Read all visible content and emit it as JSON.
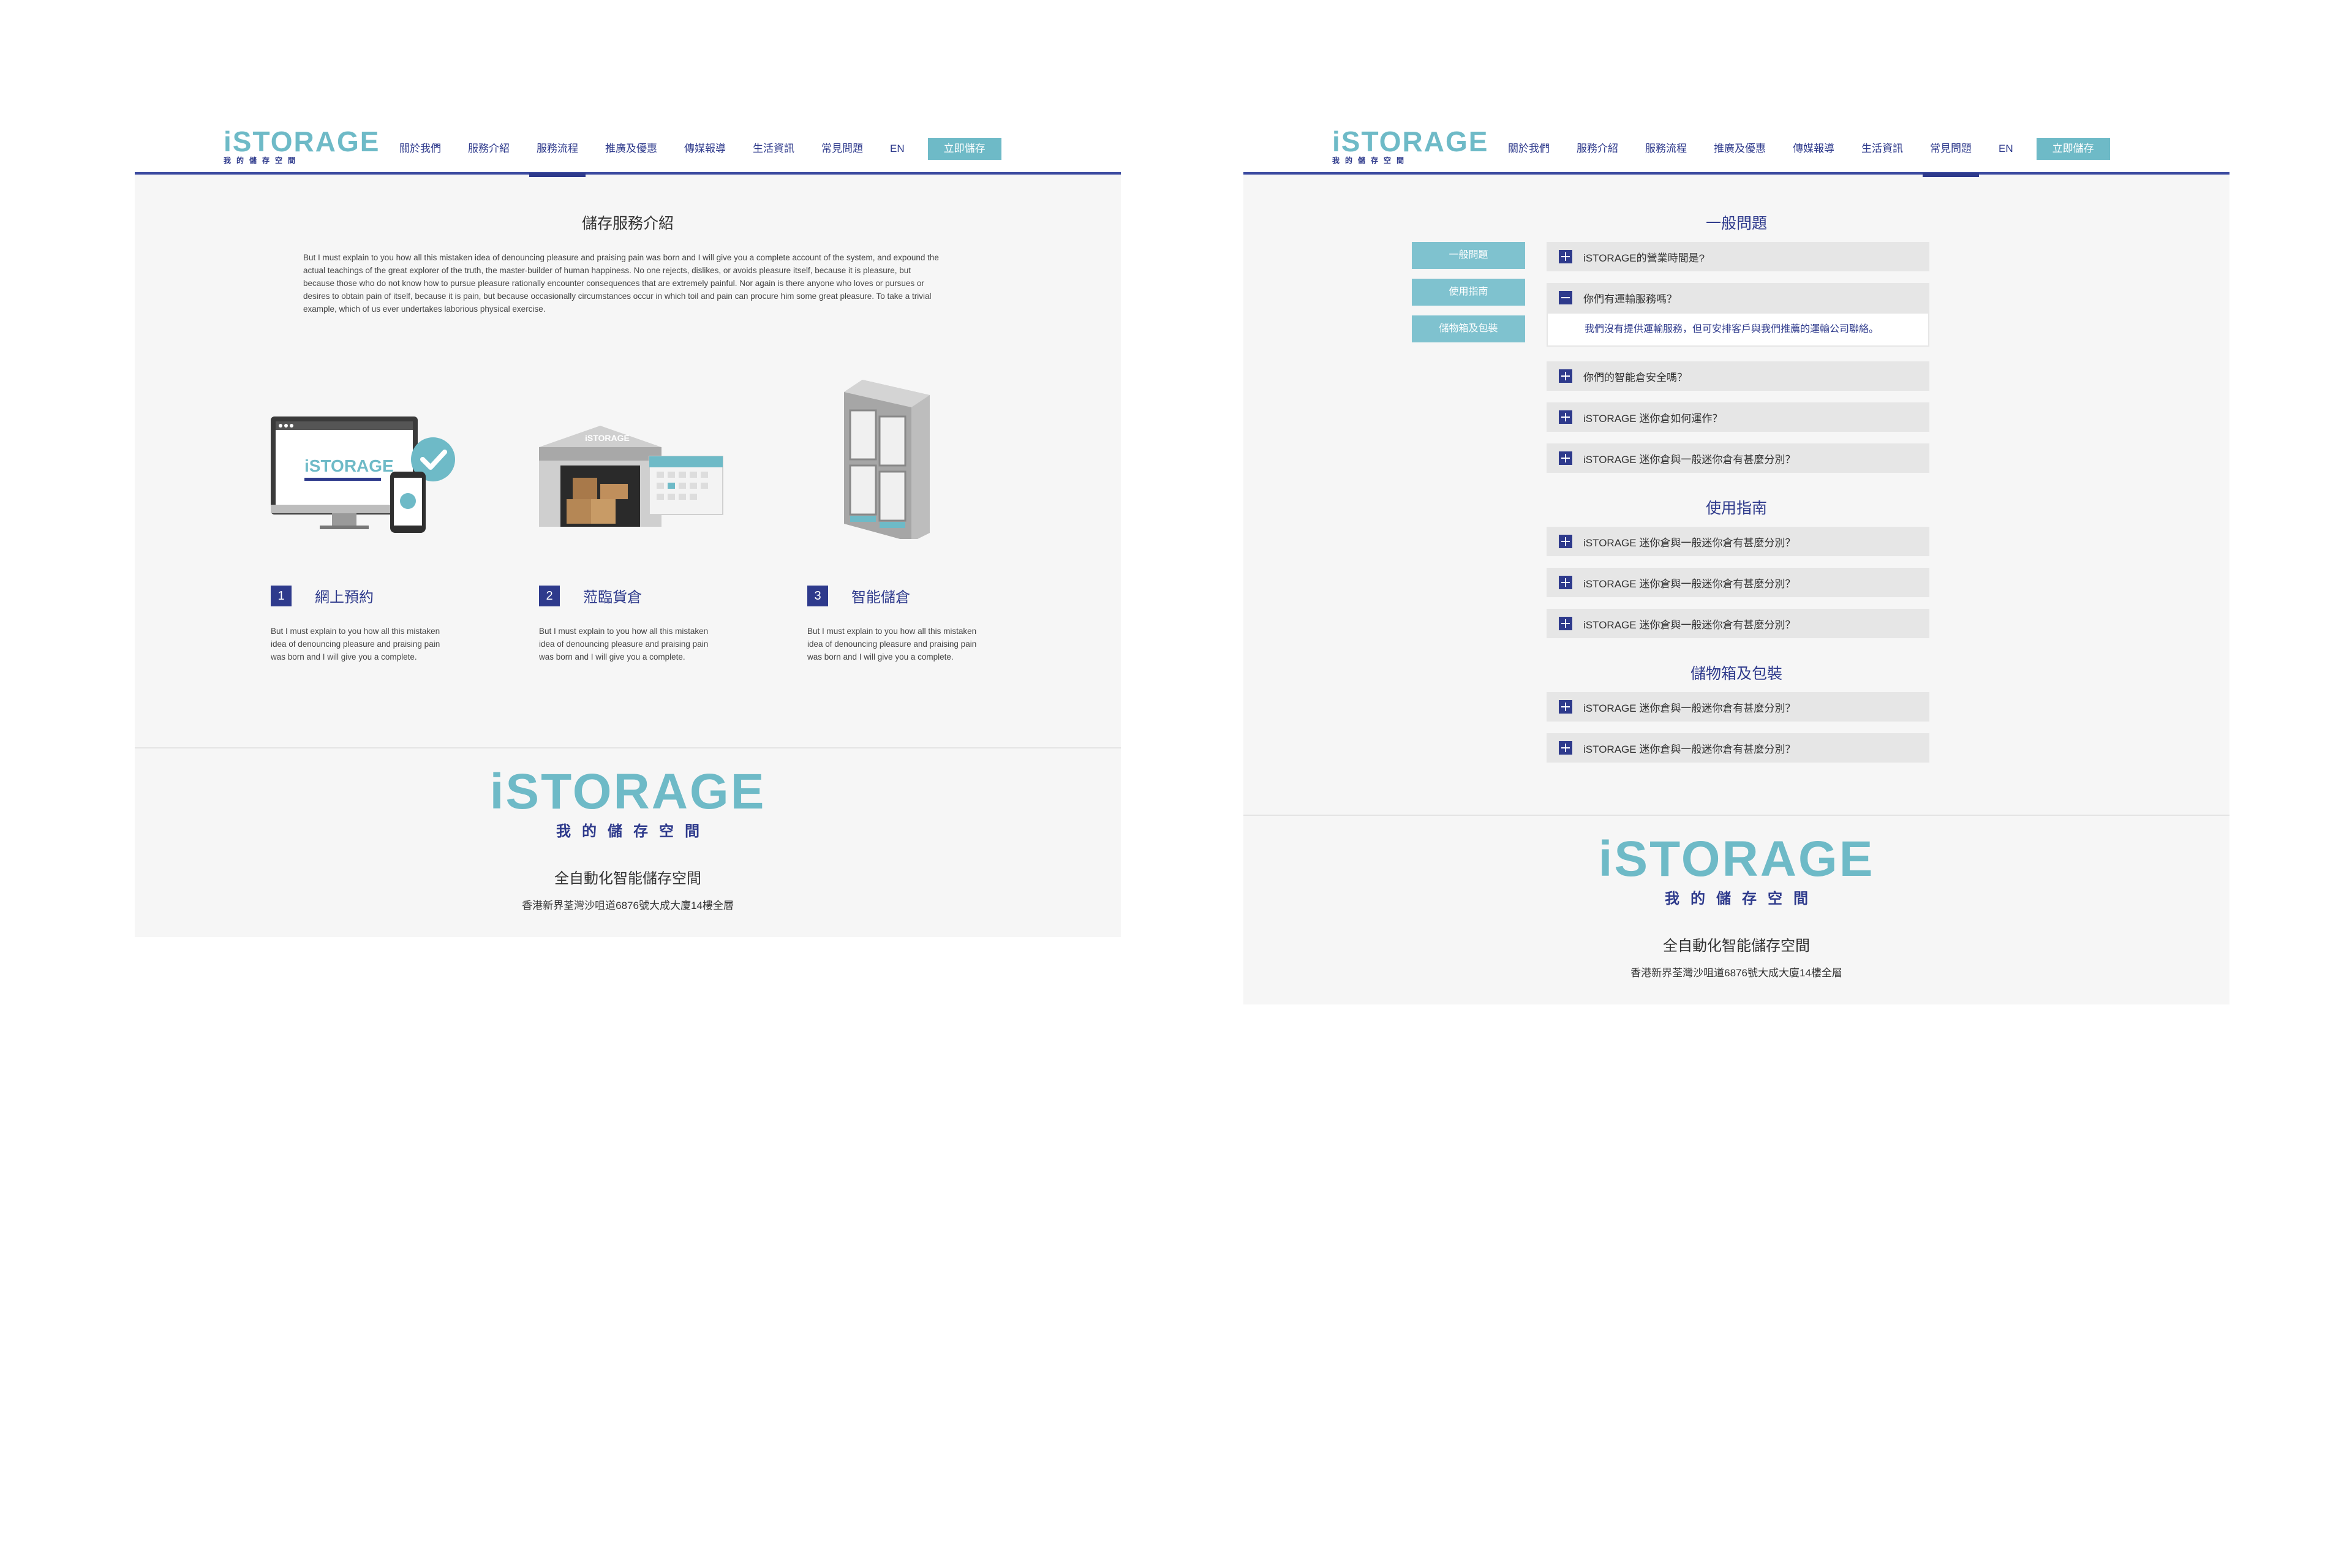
{
  "nav": {
    "logo_word": "iSTORAGE",
    "logo_sub": "我的儲存空間",
    "items": [
      "關於我們",
      "服務介紹",
      "服務流程",
      "推廣及優惠",
      "傳媒報導",
      "生活資訊",
      "常見問題"
    ],
    "lang": "EN",
    "cta": "立即儲存"
  },
  "service_page": {
    "active_nav": "服務流程",
    "title": "儲存服務介紹",
    "intro": "But I must explain to you how all this mistaken idea of denouncing pleasure and praising pain was born and I will give you a complete account of the system, and expound the actual teachings of the great explorer of the truth, the master-builder of human happiness. No one rejects, dislikes, or avoids pleasure itself, because it is pleasure, but because those who do not know how to pursue pleasure rationally encounter consequences that are extremely painful. Nor again is there anyone who loves or pursues or desires to obtain pain of itself, because it is pain, but because occasionally circumstances occur in which toil and pain can procure him some great pleasure. To take a trivial example, which of us ever undertakes laborious physical exercise.",
    "steps": [
      {
        "num": "1",
        "title": "網上預約",
        "desc": "But I must explain to you how all this mistaken idea of denouncing pleasure and praising pain was born and I will give you a complete.",
        "icon": "online-booking-illustration"
      },
      {
        "num": "2",
        "title": "蒞臨貨倉",
        "desc": "But I must explain to you how all this mistaken idea of denouncing pleasure and praising pain was born and I will give you a complete.",
        "icon": "warehouse-illustration"
      },
      {
        "num": "3",
        "title": "智能儲倉",
        "desc": "But I must explain to you how all this mistaken idea of denouncing pleasure and praising pain was born and I will give you a complete.",
        "icon": "smart-locker-illustration"
      }
    ],
    "illustration_text": "iSTORAGE"
  },
  "faq_page": {
    "active_nav": "常見問題",
    "side_tabs": [
      "一般問題",
      "使用指南",
      "儲物箱及包裝"
    ],
    "categories": [
      {
        "title": "一般問題",
        "questions": [
          {
            "q": "iSTORAGE的營業時間是?",
            "open": false
          },
          {
            "q": "你們有運輸服務嗎？",
            "open": true,
            "answer": "我們沒有提供運輸服務，但可安排客戶與我們推薦的運輸公司聯絡。"
          },
          {
            "q": "你們的智能倉安全嗎？",
            "open": false
          },
          {
            "q": "iSTORAGE 迷你倉如何運作？",
            "open": false
          },
          {
            "q": "iSTORAGE 迷你倉與一般迷你倉有甚麼分別？",
            "open": false
          }
        ]
      },
      {
        "title": "使用指南",
        "questions": [
          {
            "q": "iSTORAGE 迷你倉與一般迷你倉有甚麼分別？",
            "open": false
          },
          {
            "q": "iSTORAGE 迷你倉與一般迷你倉有甚麼分別？",
            "open": false
          },
          {
            "q": "iSTORAGE 迷你倉與一般迷你倉有甚麼分別？",
            "open": false
          }
        ]
      },
      {
        "title": "儲物箱及包裝",
        "questions": [
          {
            "q": "iSTORAGE 迷你倉與一般迷你倉有甚麼分別？",
            "open": false
          },
          {
            "q": "iSTORAGE 迷你倉與一般迷你倉有甚麼分別？",
            "open": false
          }
        ]
      }
    ]
  },
  "footer": {
    "logo_word": "iSTORAGE",
    "logo_sub": "我的儲存空間",
    "slogan": "全自動化智能儲存空間",
    "address": "香港新界荃灣沙咀道6876號大成大廈14樓全層"
  },
  "colors": {
    "teal": "#6ebac7",
    "navy": "#2e3a8c",
    "panel": "#f6f6f6",
    "faq_bg": "#e6e6e6"
  }
}
